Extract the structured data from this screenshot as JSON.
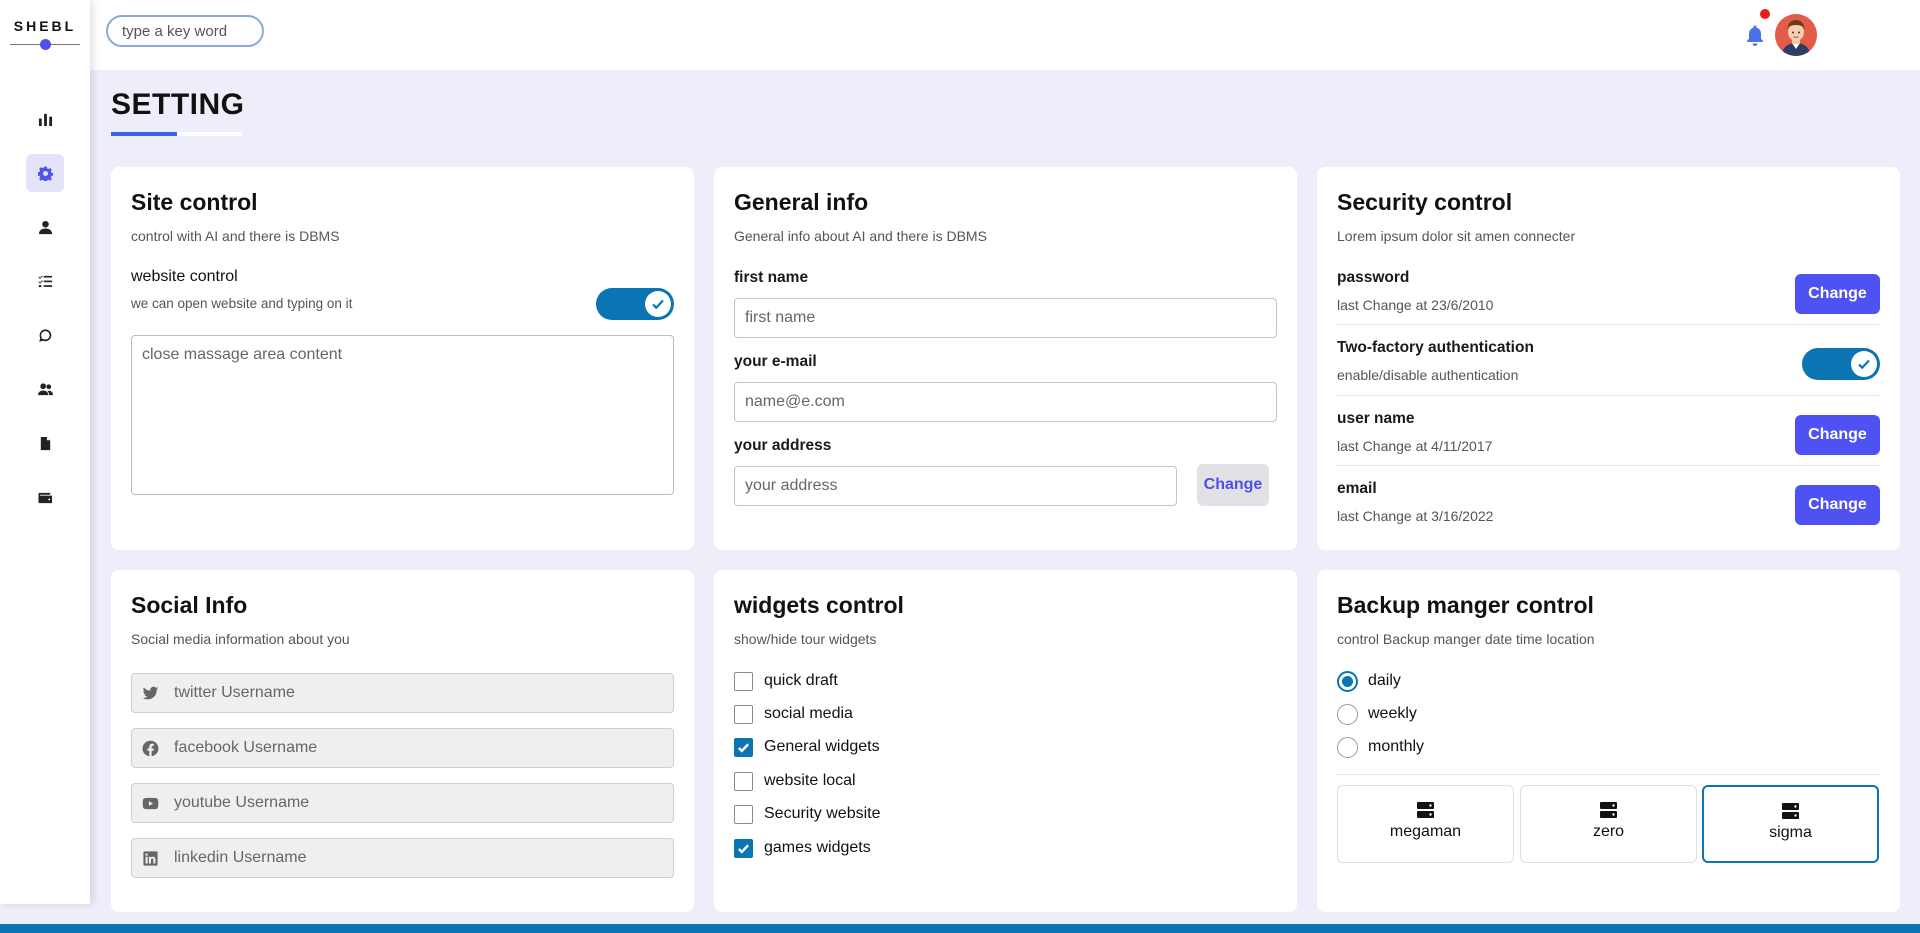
{
  "app": {
    "logo": "SHEBL"
  },
  "search": {
    "placeholder": "type a key word"
  },
  "sidebar": {
    "items": [
      {
        "icon": "chart-icon",
        "active": false
      },
      {
        "icon": "gear-icon",
        "active": true
      },
      {
        "icon": "user-icon",
        "active": false
      },
      {
        "icon": "tasks-icon",
        "active": false
      },
      {
        "icon": "chat-icon",
        "active": false
      },
      {
        "icon": "users-icon",
        "active": false
      },
      {
        "icon": "file-icon",
        "active": false
      },
      {
        "icon": "wallet-icon",
        "active": false
      }
    ]
  },
  "header": {
    "notification_icon": "bell-icon",
    "has_notification": true,
    "avatar": "avatar"
  },
  "page": {
    "title": "SETTING"
  },
  "site_control": {
    "title": "Site control",
    "subtitle": "control with AI and there is DBMS",
    "website_control_label": "website control",
    "website_control_desc": "we can open website and typing on it",
    "website_control_enabled": true,
    "textarea_placeholder": "close massage area content"
  },
  "general_info": {
    "title": "General info",
    "subtitle": "General info about AI and there is DBMS",
    "first_name_label": "first name",
    "first_name_placeholder": "first name",
    "email_label": "your e-mail",
    "email_placeholder": "name@e.com",
    "address_label": "your address",
    "address_placeholder": "your address",
    "change_label": "Change"
  },
  "security": {
    "title": "Security control",
    "subtitle": "Lorem ipsum dolor sit amen connecter",
    "password_label": "password",
    "password_date": "last Change at 23/6/2010",
    "twofa_label": "Two-factory authentication",
    "twofa_desc": "enable/disable authentication",
    "twofa_enabled": true,
    "username_label": "user name",
    "username_date": "last Change at 4/11/2017",
    "email_label": "email",
    "email_date": "last Change at 3/16/2022",
    "change_label": "Change"
  },
  "social": {
    "title": "Social Info",
    "subtitle": "Social media information about you",
    "twitter_placeholder": "twitter Username",
    "facebook_placeholder": "facebook Username",
    "youtube_placeholder": "youtube Username",
    "linkedin_placeholder": "linkedin Username"
  },
  "widgets": {
    "title": "widgets control",
    "subtitle": "show/hide tour widgets",
    "items": [
      {
        "label": "quick draft",
        "checked": false
      },
      {
        "label": "social media",
        "checked": false
      },
      {
        "label": "General widgets",
        "checked": true
      },
      {
        "label": "website local",
        "checked": false
      },
      {
        "label": "Security website",
        "checked": false
      },
      {
        "label": "games widgets",
        "checked": true
      }
    ]
  },
  "backup": {
    "title": "Backup manger control",
    "subtitle": "control Backup manger date time location",
    "options": [
      {
        "label": "daily",
        "checked": true
      },
      {
        "label": "weekly",
        "checked": false
      },
      {
        "label": "monthly",
        "checked": false
      }
    ],
    "servers": [
      {
        "label": "megaman",
        "active": false
      },
      {
        "label": "zero",
        "active": false
      },
      {
        "label": "sigma",
        "active": true
      }
    ]
  },
  "colors": {
    "accent": "#4f52f2",
    "toggle": "#0b74b3",
    "background": "#eeeefb"
  }
}
